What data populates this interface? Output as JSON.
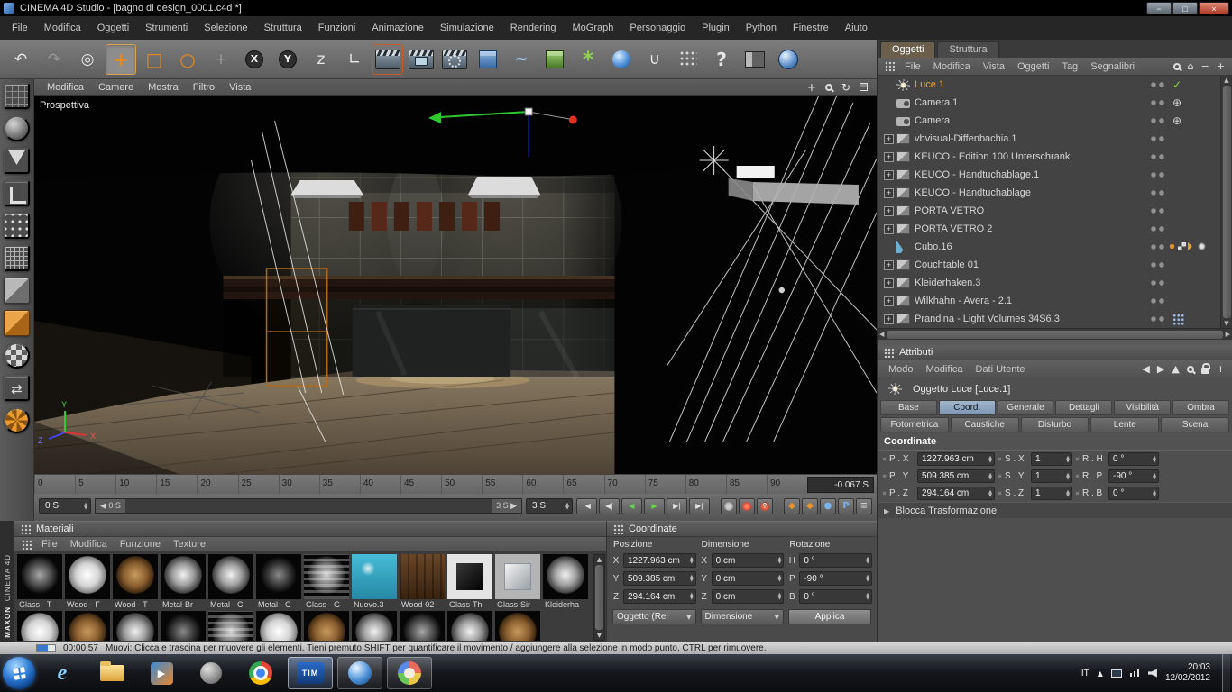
{
  "window": {
    "title": "CINEMA 4D Studio - [bagno di design_0001.c4d *]",
    "buttons": {
      "minimize": "−",
      "maximize": "□",
      "close": "×"
    }
  },
  "menu_bar": [
    "File",
    "Modifica",
    "Oggetti",
    "Strumenti",
    "Selezione",
    "Struttura",
    "Funzioni",
    "Animazione",
    "Simulazione",
    "Rendering",
    "MoGraph",
    "Personaggio",
    "Plugin",
    "Python",
    "Finestre",
    "Aiuto"
  ],
  "toolbar": {
    "buttons": [
      {
        "name": "undo-button",
        "glyph": "↶",
        "cls": "lite"
      },
      {
        "name": "redo-button",
        "glyph": "↷",
        "cls": "dim"
      },
      {
        "name": "live-selection-button",
        "glyph": "◎",
        "cls": "lite"
      },
      {
        "name": "move-tool-button",
        "glyph": "+",
        "cls": "orange active"
      },
      {
        "name": "scale-tool-button",
        "glyph": "□",
        "cls": "orange"
      },
      {
        "name": "rotate-tool-button",
        "glyph": "○",
        "cls": "orange"
      },
      {
        "name": "last-tool-button",
        "glyph": "+",
        "cls": "dim"
      },
      {
        "name": "lock-x-axis-button",
        "glyph": "X",
        "cls": "circ"
      },
      {
        "name": "lock-y-axis-button",
        "glyph": "Y",
        "cls": "circ"
      },
      {
        "name": "lock-z-axis-button",
        "glyph": "z",
        "cls": "lite"
      },
      {
        "name": "coordinate-system-button",
        "glyph": "∟",
        "cls": "lite"
      },
      {
        "name": "render-view-button",
        "glyph": "",
        "cls": "clapper rframe"
      },
      {
        "name": "render-picture-viewer-button",
        "glyph": "",
        "cls": "clapper pic"
      },
      {
        "name": "render-settings-button",
        "glyph": "",
        "cls": "clapper gear"
      },
      {
        "name": "add-cube-button",
        "glyph": "",
        "cls": "cube"
      },
      {
        "name": "add-spline-button",
        "glyph": "~",
        "cls": "blue"
      },
      {
        "name": "add-generator-button",
        "glyph": "",
        "cls": "gcube"
      },
      {
        "name": "add-mograph-button",
        "glyph": "*",
        "cls": "green"
      },
      {
        "name": "add-deformer-button",
        "glyph": "",
        "cls": "bsphere"
      },
      {
        "name": "snap-button",
        "glyph": "∪",
        "cls": "lite"
      },
      {
        "name": "workplane-button",
        "glyph": "",
        "cls": "dots"
      },
      {
        "name": "help-button",
        "glyph": "?",
        "cls": "lite big"
      },
      {
        "name": "display-mode-button",
        "glyph": "",
        "cls": "panel"
      },
      {
        "name": "content-browser-button",
        "glyph": "",
        "cls": "globe"
      }
    ]
  },
  "left_toolbar": [
    {
      "name": "convert-object-icon",
      "cls": "k-grid"
    },
    {
      "name": "model-mode-icon",
      "cls": "k-sphere"
    },
    {
      "name": "texture-mode-icon",
      "cls": "k-tri"
    },
    {
      "name": "workplane-mode-icon",
      "cls": "k-corner"
    },
    {
      "name": "points-mode-icon",
      "cls": "k-dotsq"
    },
    {
      "name": "edges-mode-icon",
      "cls": "k-mesh"
    },
    {
      "name": "polygons-mode-icon",
      "cls": "k-cube"
    },
    {
      "name": "object-mode-icon",
      "cls": "k-cubeorange"
    },
    {
      "name": "texture-axis-icon",
      "cls": "k-checkerball"
    },
    {
      "name": "axis-mode-icon",
      "cls": "k-arrows"
    },
    {
      "name": "mograph-tool-icon",
      "cls": "k-wheel"
    }
  ],
  "viewport": {
    "label": "Prospettiva",
    "menus": [
      "Modifica",
      "Camere",
      "Mostra",
      "Filtro",
      "Vista"
    ],
    "axis": {
      "x": "X",
      "y": "Y",
      "z": "Z"
    }
  },
  "timeline": {
    "ticks": [
      "0",
      "5",
      "10",
      "15",
      "20",
      "25",
      "30",
      "35",
      "40",
      "45",
      "50",
      "55",
      "60",
      "65",
      "70",
      "75",
      "80",
      "85",
      "90"
    ],
    "current": "-0.067 S",
    "start_spinner": "0 S",
    "marker_start": "◀ 0 S",
    "marker_end": "3 S ▶",
    "end_value": "3 S",
    "playback": [
      {
        "name": "goto-start-button",
        "glyph": "|◀",
        "cls": ""
      },
      {
        "name": "prev-key-button",
        "glyph": "◀|",
        "cls": ""
      },
      {
        "name": "prev-frame-button",
        "glyph": "◀",
        "cls": "green"
      },
      {
        "name": "play-button",
        "glyph": "▶",
        "cls": "green"
      },
      {
        "name": "next-frame-button",
        "glyph": "▶|",
        "cls": ""
      },
      {
        "name": "goto-end-button",
        "glyph": "▶|",
        "cls": ""
      }
    ],
    "records": [
      {
        "name": "record-keyframe-button",
        "cls": "gray",
        "glyph": ""
      },
      {
        "name": "autokey-button",
        "cls": "red",
        "glyph": ""
      },
      {
        "name": "record-options-button",
        "cls": "red",
        "glyph": "?"
      }
    ],
    "key_toggles": [
      {
        "name": "key-position-toggle",
        "glyph": "◆",
        "cls": "orange"
      },
      {
        "name": "key-scale-toggle",
        "glyph": "◆",
        "cls": "orange"
      },
      {
        "name": "key-rotation-toggle",
        "glyph": "●",
        "cls": "blue"
      },
      {
        "name": "key-parameter-toggle",
        "glyph": "P",
        "cls": "blue"
      },
      {
        "name": "key-pla-toggle",
        "glyph": "≡",
        "cls": "gray"
      }
    ]
  },
  "object_manager": {
    "tabs": [
      {
        "label": "Oggetti",
        "cls": "active"
      },
      {
        "label": "Struttura",
        "cls": ""
      }
    ],
    "menus": [
      "File",
      "Modifica",
      "Vista",
      "Oggetti",
      "Tag",
      "Segnalibri"
    ],
    "items": [
      {
        "label": "Luce.1",
        "icon": "ic-light",
        "cls": "selected",
        "tag": "t-check"
      },
      {
        "label": "Camera.1",
        "icon": "ic-camera",
        "tag": "t-target"
      },
      {
        "label": "Camera",
        "icon": "ic-camera",
        "tag": "t-target"
      },
      {
        "label": "vbvisual-Diffenbachia.1",
        "icon": "ic-null",
        "exp": "on"
      },
      {
        "label": "KEUCO - Edition 100 Unterschrank",
        "icon": "ic-null",
        "exp": "on"
      },
      {
        "label": "KEUCO - Handtuchablage.1",
        "icon": "ic-null",
        "exp": "on"
      },
      {
        "label": "KEUCO - Handtuchablage",
        "icon": "ic-null",
        "exp": "on"
      },
      {
        "label": "PORTA VETRO",
        "icon": "ic-null",
        "exp": "on"
      },
      {
        "label": "PORTA VETRO 2",
        "icon": "ic-null",
        "exp": "on"
      },
      {
        "label": "Cubo.16",
        "icon": "ic-cone",
        "tag": "t-texture"
      },
      {
        "label": "Couchtable 01",
        "icon": "ic-null",
        "exp": "on"
      },
      {
        "label": "Kleiderhaken.3",
        "icon": "ic-null",
        "exp": "on"
      },
      {
        "label": "Wilkhahn - Avera - 2.1",
        "icon": "ic-null",
        "exp": "on"
      },
      {
        "label": "Prandina - Light Volumes 34S6.3",
        "icon": "ic-null",
        "exp": "on",
        "tag": "t-dots"
      }
    ]
  },
  "attributes": {
    "title": "Attributi",
    "menus": [
      "Modo",
      "Modifica",
      "Dati Utente"
    ],
    "object_label": "Oggetto Luce [Luce.1]",
    "tabs_row1": [
      {
        "label": "Base",
        "cls": ""
      },
      {
        "label": "Coord.",
        "cls": "active"
      },
      {
        "label": "Generale",
        "cls": ""
      },
      {
        "label": "Dettagli",
        "cls": ""
      },
      {
        "label": "Visibilità",
        "cls": ""
      },
      {
        "label": "Ombra",
        "cls": ""
      }
    ],
    "tabs_row2": [
      {
        "label": "Fotometrica",
        "cls": ""
      },
      {
        "label": "Caustiche",
        "cls": ""
      },
      {
        "label": "Disturbo",
        "cls": ""
      },
      {
        "label": "Lente",
        "cls": ""
      },
      {
        "label": "Scena",
        "cls": ""
      }
    ],
    "section_title": "Coordinate",
    "rows": [
      {
        "p_label": "P . X",
        "p_value": "1227.963 cm",
        "s_label": "S . X",
        "s_value": "1",
        "r_label": "R . H",
        "r_value": "0 °"
      },
      {
        "p_label": "P . Y",
        "p_value": "509.385 cm",
        "s_label": "S . Y",
        "s_value": "1",
        "r_label": "R . P",
        "r_value": "-90 °"
      },
      {
        "p_label": "P . Z",
        "p_value": "294.164 cm",
        "s_label": "S . Z",
        "s_value": "1",
        "r_label": "R . B",
        "r_value": "0 °"
      }
    ],
    "footer": "Blocca Trasformazione"
  },
  "materials": {
    "title": "Materiali",
    "menus": [
      "File",
      "Modifica",
      "Funzione",
      "Texture"
    ],
    "items": [
      {
        "label": "Glass - T",
        "kind": "k-glassdark"
      },
      {
        "label": "Wood - F",
        "kind": "k-white"
      },
      {
        "label": "Wood - T",
        "kind": "k-wood"
      },
      {
        "label": "Metal-Br",
        "kind": "k-metal"
      },
      {
        "label": "Metal - C",
        "kind": "k-metal"
      },
      {
        "label": "Metal - C",
        "kind": "k-dark"
      },
      {
        "label": "Glass - G",
        "kind": "k-striped"
      },
      {
        "label": "Nuovo.3",
        "kind": "k-blueflat"
      },
      {
        "label": "Wood-02",
        "kind": "k-woodflat"
      },
      {
        "label": "Glass-Th",
        "kind": "k-blackcube"
      },
      {
        "label": "Glass-Sir",
        "kind": "k-glasscube"
      },
      {
        "label": "Kleiderha",
        "kind": "k-metal"
      },
      {
        "label": "",
        "kind": "k-white"
      },
      {
        "label": "",
        "kind": "k-wood"
      },
      {
        "label": "",
        "kind": "k-metal"
      },
      {
        "label": "",
        "kind": "k-dark"
      },
      {
        "label": "",
        "kind": "k-striped"
      },
      {
        "label": "",
        "kind": "k-white"
      },
      {
        "label": "",
        "kind": "k-wood"
      },
      {
        "label": "",
        "kind": "k-metal"
      },
      {
        "label": "",
        "kind": "k-glassdark"
      },
      {
        "label": "",
        "kind": "k-metal"
      },
      {
        "label": "",
        "kind": "k-wood"
      }
    ]
  },
  "coord_panel": {
    "title": "Coordinate",
    "col_headers": [
      "Posizione",
      "Dimensione",
      "Rotazione"
    ],
    "position": [
      {
        "axis": "X",
        "value": "1227.963 cm"
      },
      {
        "axis": "Y",
        "value": "509.385 cm"
      },
      {
        "axis": "Z",
        "value": "294.164 cm"
      }
    ],
    "dimension": [
      {
        "axis": "X",
        "value": "0 cm"
      },
      {
        "axis": "Y",
        "value": "0 cm"
      },
      {
        "axis": "Z",
        "value": "0 cm"
      }
    ],
    "rotation": [
      {
        "axis": "H",
        "value": "0 °"
      },
      {
        "axis": "P",
        "value": "-90 °"
      },
      {
        "axis": "B",
        "value": "0 °"
      }
    ],
    "mode_dropdown": "Oggetto (Rel",
    "dim_dropdown": "Dimensione",
    "apply": "Applica"
  },
  "status": {
    "time": "00:00:57",
    "message": "Muovi: Clicca e trascina per muovere gli elementi. Tieni premuto SHIFT per quantificare il movimento / aggiungere alla selezione in modo punto, CTRL per rimuovere."
  },
  "taskbar": {
    "tim_label": "TIM",
    "media_glyph": "▶",
    "lang": "IT",
    "time": "20:03",
    "date": "12/02/2012"
  },
  "branding": {
    "maxon": "MAXON",
    "c4d": "CINEMA 4D"
  }
}
